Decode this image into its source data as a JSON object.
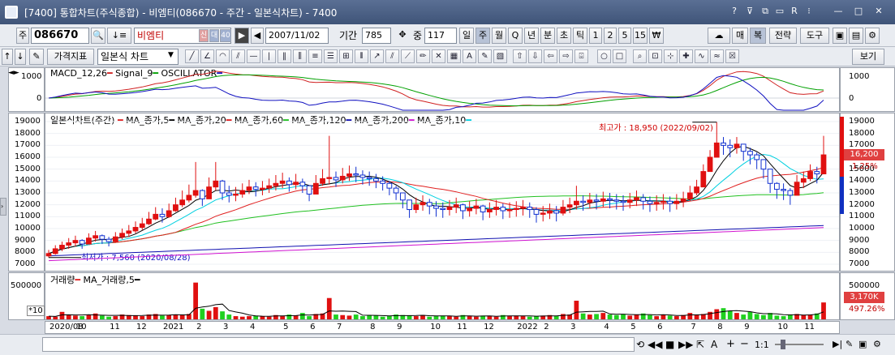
{
  "window": {
    "title": "[7400] 통합차트(주식종합) - 비엠티(086670 - 주간 - 일본식차트) - 7400"
  },
  "toolbar": {
    "market_label": "주",
    "code": "086670",
    "name": "비엠티",
    "badges": [
      "신",
      "대",
      "40"
    ],
    "date": "2007/11/02",
    "period_label": "기간",
    "period_value": "785",
    "mid_label": "중",
    "mid_value": "117",
    "intervals": [
      "일",
      "주",
      "월",
      "Q",
      "년",
      "분",
      "초",
      "틱",
      "1",
      "2",
      "5",
      "15",
      "₩"
    ],
    "selected_interval": "주",
    "right_buttons": [
      "매",
      "복",
      "전략",
      "도구"
    ],
    "price_indicator_label": "가격지표",
    "chart_type": "일본식 차트",
    "view_button": "보기"
  },
  "macd": {
    "legend": [
      "MACD_12,26",
      "Signal_9",
      "OSCILLATOR"
    ],
    "legend_colors": [
      "#d02020",
      "#00a000",
      "#1010c0"
    ],
    "ticks": [
      "1000",
      "0"
    ]
  },
  "price": {
    "legend_title": "일본식차트(주간)",
    "legend": [
      "MA_종가,5",
      "MA_종가,20",
      "MA_종가,60",
      "MA_종가,120",
      "MA_종가,200",
      "MA_종가,10"
    ],
    "legend_colors": [
      "#000000",
      "#e02020",
      "#20c020",
      "#1010b0",
      "#d010d0",
      "#00d0e0"
    ],
    "ticks": [
      "19000",
      "18000",
      "17000",
      "16000",
      "15000",
      "14000",
      "13000",
      "12000",
      "11000",
      "10000",
      "9000",
      "8000",
      "7000"
    ],
    "high_label": "최고가 : 18,950 (2022/09/02)",
    "low_label": "최저가 : 7,560 (2020/08/28)",
    "current_price": "16,200",
    "change_pct": "1.25%"
  },
  "volume": {
    "legend": [
      "거래량",
      "MA_거래량,5"
    ],
    "ticks": [
      "500000",
      "0"
    ],
    "multiplier": "*10",
    "current_volume": "3,170K",
    "volume_pct": "497.26%"
  },
  "xaxis": {
    "labels": [
      "2020/08",
      "10",
      "11",
      "12",
      "2021",
      "2",
      "3",
      "4",
      "5",
      "6",
      "7",
      "8",
      "9",
      "10",
      "11",
      "12",
      "2022",
      "2",
      "3",
      "4",
      "5",
      "6",
      "7",
      "8",
      "9",
      "10",
      "11"
    ]
  },
  "bottombar": {
    "zoom": "1:1"
  },
  "chart_data": {
    "type": "candlestick",
    "interval": "weekly",
    "ylim": [
      7000,
      19000
    ],
    "close": [
      7900,
      8300,
      8600,
      8800,
      9000,
      8700,
      9200,
      9400,
      9100,
      8900,
      9300,
      9600,
      9800,
      10100,
      10400,
      10800,
      11200,
      11000,
      11500,
      12000,
      12400,
      12800,
      13200,
      12500,
      13500,
      14000,
      13000,
      12800,
      12900,
      13200,
      13500,
      13300,
      13400,
      13600,
      13800,
      14000,
      13700,
      13900,
      13600,
      12900,
      13800,
      14200,
      14300,
      14100,
      14400,
      14600,
      14500,
      14300,
      14200,
      14000,
      13800,
      13400,
      13000,
      12400,
      11600,
      12000,
      12200,
      11900,
      11700,
      11600,
      11800,
      12000,
      11500,
      11700,
      11900,
      11400,
      11600,
      11800,
      11500,
      11600,
      11700,
      11800,
      11600,
      11200,
      11300,
      11500,
      11300,
      11800,
      12000,
      12300,
      12200,
      12400,
      12300,
      12500,
      12400,
      12300,
      12200,
      12400,
      12600,
      12300,
      12100,
      12200,
      12300,
      12100,
      12300,
      12500,
      13000,
      13500,
      14800,
      16000,
      17200,
      17000,
      16800,
      17100,
      16500,
      16200,
      15800,
      15000,
      13800,
      13300,
      13200,
      12800,
      13900,
      14200,
      14800,
      14600,
      16200
    ],
    "high": [
      8200,
      8600,
      8900,
      9200,
      9400,
      9100,
      9600,
      9800,
      9500,
      9300,
      9700,
      10000,
      10300,
      10600,
      10900,
      11400,
      11800,
      11700,
      12100,
      12600,
      13200,
      13700,
      15600,
      13300,
      14300,
      15600,
      14100,
      13600,
      13500,
      13800,
      14100,
      13900,
      14000,
      14200,
      14500,
      14700,
      14300,
      14600,
      14200,
      13600,
      14500,
      15000,
      17800,
      14800,
      15100,
      15300,
      15200,
      14900,
      14800,
      14600,
      14400,
      14000,
      13600,
      13000,
      12300,
      12600,
      12800,
      12500,
      12300,
      12200,
      12400,
      12600,
      12100,
      12300,
      12500,
      12000,
      12200,
      12400,
      12100,
      12200,
      12300,
      12400,
      12200,
      11800,
      11900,
      12100,
      11900,
      12400,
      12600,
      13600,
      12800,
      13000,
      12900,
      13100,
      13000,
      12900,
      12800,
      13000,
      13200,
      12900,
      12700,
      12800,
      12900,
      12700,
      12900,
      13100,
      13600,
      14100,
      15400,
      16600,
      18950,
      17700,
      17500,
      17700,
      17100,
      16800,
      16400,
      15600,
      14400,
      13900,
      13800,
      13400,
      14500,
      14800,
      15400,
      15200,
      17800
    ],
    "low": [
      7560,
      7800,
      8100,
      8300,
      8500,
      8300,
      8700,
      8900,
      8700,
      8500,
      8800,
      9100,
      9300,
      9600,
      9900,
      10300,
      10700,
      10500,
      10900,
      11400,
      11800,
      12200,
      12600,
      11900,
      12700,
      13200,
      12400,
      12200,
      12300,
      12600,
      12900,
      12700,
      12800,
      13000,
      13200,
      13400,
      13100,
      13300,
      13000,
      12300,
      13100,
      13600,
      13700,
      13500,
      13800,
      14000,
      13900,
      13700,
      13600,
      13400,
      13200,
      12800,
      12400,
      11700,
      10900,
      11300,
      11500,
      11200,
      11000,
      10900,
      11100,
      11300,
      10800,
      11000,
      11200,
      10700,
      10900,
      11100,
      10800,
      10900,
      11000,
      11100,
      10900,
      10500,
      10600,
      10800,
      10600,
      11100,
      11300,
      11600,
      11500,
      11700,
      11600,
      11800,
      11700,
      11600,
      11500,
      11700,
      11900,
      11600,
      11400,
      11500,
      11600,
      11400,
      11600,
      11800,
      12300,
      12800,
      13900,
      15000,
      16300,
      16200,
      16000,
      16300,
      15700,
      15400,
      15000,
      14200,
      13000,
      12500,
      12400,
      12000,
      13100,
      13400,
      14000,
      13800,
      15300
    ],
    "volume": [
      60000,
      50000,
      140000,
      90000,
      70000,
      60000,
      80000,
      110000,
      70000,
      50000,
      60000,
      90000,
      80000,
      70000,
      60000,
      90000,
      100000,
      70000,
      80000,
      90000,
      80000,
      100000,
      690000,
      200000,
      160000,
      230000,
      150000,
      90000,
      60000,
      50000,
      60000,
      70000,
      60000,
      50000,
      80000,
      60000,
      90000,
      70000,
      120000,
      60000,
      100000,
      110000,
      400000,
      90000,
      80000,
      70000,
      90000,
      60000,
      80000,
      70000,
      50000,
      60000,
      90000,
      80000,
      70000,
      60000,
      80000,
      50000,
      60000,
      70000,
      60000,
      50000,
      80000,
      60000,
      50000,
      70000,
      60000,
      50000,
      80000,
      60000,
      70000,
      60000,
      50000,
      60000,
      70000,
      80000,
      60000,
      100000,
      90000,
      350000,
      110000,
      90000,
      100000,
      120000,
      90000,
      80000,
      100000,
      70000,
      90000,
      110000,
      80000,
      60000,
      90000,
      70000,
      60000,
      80000,
      120000,
      90000,
      100000,
      140000,
      190000,
      210000,
      160000,
      120000,
      90000,
      140000,
      100000,
      80000,
      120000,
      70000,
      60000,
      90000,
      100000,
      80000,
      90000,
      110000,
      317000
    ]
  }
}
